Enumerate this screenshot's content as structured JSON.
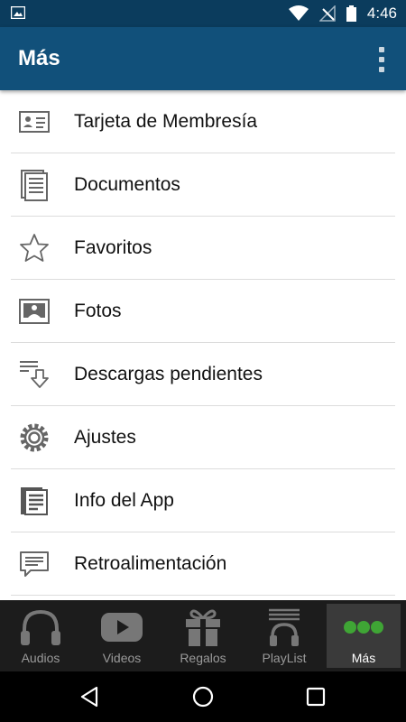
{
  "status_bar": {
    "time": "4:46"
  },
  "app_bar": {
    "title": "Más"
  },
  "menu": [
    {
      "label": "Tarjeta de Membresía",
      "icon": "membership-card-icon"
    },
    {
      "label": "Documentos",
      "icon": "documents-icon"
    },
    {
      "label": "Favoritos",
      "icon": "star-icon"
    },
    {
      "label": "Fotos",
      "icon": "photo-icon"
    },
    {
      "label": "Descargas pendientes",
      "icon": "download-icon"
    },
    {
      "label": "Ajustes",
      "icon": "gear-icon"
    },
    {
      "label": "Info del App",
      "icon": "info-document-icon"
    },
    {
      "label": "Retroalimentación",
      "icon": "feedback-icon"
    }
  ],
  "tabs": [
    {
      "label": "Audios",
      "icon": "headphones-icon"
    },
    {
      "label": "Videos",
      "icon": "play-icon"
    },
    {
      "label": "Regalos",
      "icon": "gift-icon"
    },
    {
      "label": "PlayList",
      "icon": "playlist-icon"
    },
    {
      "label": "Más",
      "icon": "more-dots-icon",
      "active": true
    }
  ],
  "colors": {
    "status_bar": "#0b3c5d",
    "app_bar": "#11507a",
    "tab_bar": "#1c1c1c",
    "active_tab": "#3a3a3a",
    "accent_green": "#3fa535"
  }
}
